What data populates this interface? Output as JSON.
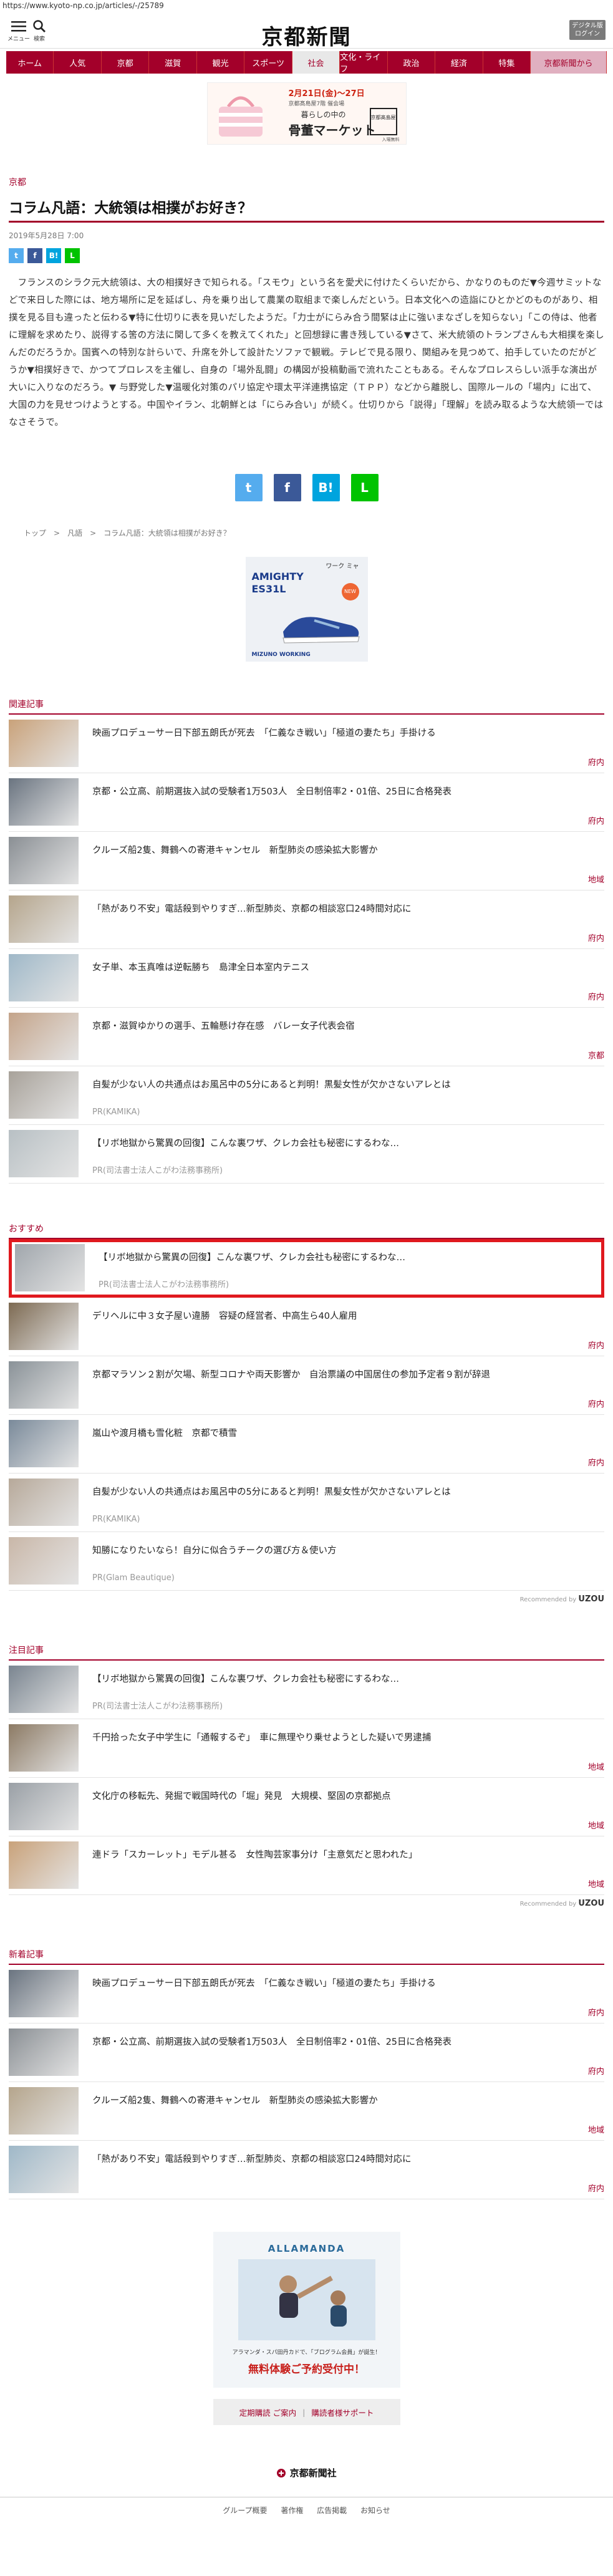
{
  "browser": {
    "url": "https://www.kyoto-np.co.jp/articles/-/25789"
  },
  "header": {
    "menu_label": "メニュー",
    "search_label": "検索",
    "logo": "京都新聞",
    "digital_label_1": "デジタル版",
    "digital_label_2": "ログイン"
  },
  "nav": {
    "items": [
      "ホーム",
      "人気",
      "京都",
      "滋賀",
      "観光",
      "スポーツ",
      "社会",
      "文化・ライフ",
      "政治",
      "経済",
      "特集",
      "京都新聞から"
    ],
    "selected": "社会"
  },
  "top_ad": {
    "date_text": "2月21日(金)～27日",
    "sub_text": "京都髙島屋7階 催会場",
    "headline": "暮らしの中の",
    "title": "骨董マーケット",
    "seal": "京都髙島屋",
    "badge": "入場無料"
  },
  "article": {
    "category": "京都",
    "title": "コラム凡語：大統領は相撲がお好き？",
    "date": "2019年5月28日 7:00",
    "body": "フランスのシラク元大統領は、大の相撲好きで知られる。「スモウ」という名を愛犬に付けたくらいだから、かなりのものだ▼今週サミットなどで来日した際には、地方場所に足を延ばし、舟を乗り出して農業の取組まで楽しんだという。日本文化への造詣にひとかどのものがあり、相撲を見る目も違ったと伝わる▼特に仕切りに表を見いだしたようだ。「力士がにらみ合う間緊は止に強いまなざしを知らない」「この侍は、他者に理解を求めたり、説得する筈の方法に関して多くを教えてくれた」と回想録に書き残している▼さて、米大統領のトランプさんも大相撲を楽しんだのだろうか。国賓への特別な計らいで、升席を外して設計たソファで観戦。テレビで見る限り、関組みを見つめて、拍手していたのだがどうか▼相撲好きで、かつてプロレスを主催し、自身の「場外乱闘」の構図が投稿動画で流れたこともある。そんなプロレスらしい派手な演出が大いに入りなのだろう。▼ 与野党した▼温暖化対策のパリ協定や環太平洋連携協定（ＴＰＰ）などから離脱し、国際ルールの「場内」に出て、大国の力を見せつけようとする。中国やイラン、北朝鮮とは「にらみ合い」が続く。仕切りから「説得」「理解」を読み取るような大統領一ではなさそうで。"
  },
  "share": {
    "twitter": "t",
    "facebook": "f",
    "hatena": "B!",
    "line": "L"
  },
  "breadcrumb": [
    "トップ",
    "凡語",
    "コラム凡語：大統領は相撲がお好き？"
  ],
  "shoe_ad": {
    "brand": "ワーク ミャ",
    "model": "AMIGHTY ES31L",
    "badge": "NEW",
    "footer": "MIZUNO WORKING"
  },
  "related": {
    "heading": "関連記事",
    "items": [
      {
        "title": "映画プロデューサー日下部五朗氏が死去　「仁義なき戦い」「極道の妻たち」手掛ける",
        "tag": "府内",
        "pr": ""
      },
      {
        "title": "京都・公立高、前期選抜入試の受験者1万503人　全日制倍率2・01倍、25日に合格発表",
        "tag": "府内",
        "pr": ""
      },
      {
        "title": "クルーズ船2隻、舞鶴への寄港キャンセル　新型肺炎の感染拡大影響か",
        "tag": "地域",
        "pr": ""
      },
      {
        "title": "「熱があり不安」電話殺到やりすぎ…新型肺炎、京都の相談窓口24時間対応に",
        "tag": "府内",
        "pr": ""
      },
      {
        "title": "女子単、本玉真唯は逆転勝ち　島津全日本室内テニス",
        "tag": "府内",
        "pr": ""
      },
      {
        "title": "京都・滋賀ゆかりの選手、五輪懸け存在感　バレー女子代表会宿",
        "tag": "京都",
        "pr": ""
      },
      {
        "title": "自髪が少ない人の共通点はお風呂中の5分にあると判明！黒髪女性が欠かさないアレとは",
        "tag": "",
        "pr": "PR(KAMIKA)"
      },
      {
        "title": "【リボ地獄から驚異の回復】こんな裏ワザ、クレカ会社も秘密にするわな…",
        "tag": "",
        "pr": "PR(司法書士法人こがわ法務事務所)"
      }
    ]
  },
  "recommended": {
    "heading": "おすすめ",
    "items": [
      {
        "title": "【リボ地獄から驚異の回復】こんな裏ワザ、クレカ会社も秘密にするわな…",
        "tag": "",
        "pr": "PR(司法書士法人こがわ法務事務所)"
      },
      {
        "title": "デリヘルに中３女子屋い違勝　容疑の経営者、中高生ら40人雇用",
        "tag": "府内",
        "pr": ""
      },
      {
        "title": "京都マラソン２割が欠場、新型コロナや両天影響か　自治票議の中国居住の参加予定者９割が辞退",
        "tag": "府内",
        "pr": ""
      },
      {
        "title": "嵐山や渡月橋も雪化粧　京都で積雪",
        "tag": "府内",
        "pr": ""
      },
      {
        "title": "自髪が少ない人の共通点はお風呂中の5分にあると判明！黒髪女性が欠かさないアレとは",
        "tag": "",
        "pr": "PR(KAMIKA)"
      },
      {
        "title": "知勝になりたいなら！自分に似合うチークの選び方＆使い方",
        "tag": "",
        "pr": "PR(Glam Beautique)"
      }
    ],
    "recommended_by": "Recommended by",
    "uzou": "UZOU"
  },
  "popular": {
    "heading": "注目記事",
    "items": [
      {
        "title": "【リボ地獄から驚異の回復】こんな裏ワザ、クレカ会社も秘密にするわな…",
        "tag": "",
        "pr": "PR(司法書士法人こがわ法務事務所)"
      },
      {
        "title": "千円拾った女子中学生に「通報するぞ」　車に無理やり乗せようとした疑いで男逮捕",
        "tag": "地域",
        "pr": ""
      },
      {
        "title": "文化庁の移転先、発掘で戦国時代の「堀」発見　大規模、堅固の京都拠点",
        "tag": "地域",
        "pr": ""
      },
      {
        "title": "連ドラ「スカーレット」モデル甚る　女性陶芸家事分け「主意気だと思われた」",
        "tag": "地域",
        "pr": ""
      }
    ],
    "recommended_by": "Recommended by",
    "uzou": "UZOU"
  },
  "latest": {
    "heading": "新着記事",
    "items": [
      {
        "title": "映画プロデューサー日下部五朗氏が死去　「仁義なき戦い」「極道の妻たち」手掛ける",
        "tag": "府内",
        "pr": ""
      },
      {
        "title": "京都・公立高、前期選抜入試の受験者1万503人　全日制倍率2・01倍、25日に合格発表",
        "tag": "府内",
        "pr": ""
      },
      {
        "title": "クルーズ船2隻、舞鶴への寄港キャンセル　新型肺炎の感染拡大影響か",
        "tag": "地域",
        "pr": ""
      },
      {
        "title": "「熱があり不安」電話殺到やりすぎ…新型肺炎、京都の相談窓口24時間対応に",
        "tag": "府内",
        "pr": ""
      }
    ]
  },
  "bottom_ad": {
    "brand": "ALLAMANDA",
    "line1": "アラマンダ・スパ田丹カドで、「ブログラム会員」が誕生！",
    "line2": "無料体験ご予約受付中！"
  },
  "footer_links": {
    "subscribe": "定期購読 ご案内",
    "support": "購読者様サポート"
  },
  "footer": {
    "logo": "京都新聞社",
    "links": [
      "グループ概要",
      "著作権",
      "広告掲載",
      "お知らせ"
    ]
  },
  "colors": {
    "brand": "#a3002a",
    "highlight": "#e0191e",
    "twitter": "#55acee",
    "facebook": "#3b5998",
    "hatena": "#00a4de",
    "line": "#00c300"
  }
}
